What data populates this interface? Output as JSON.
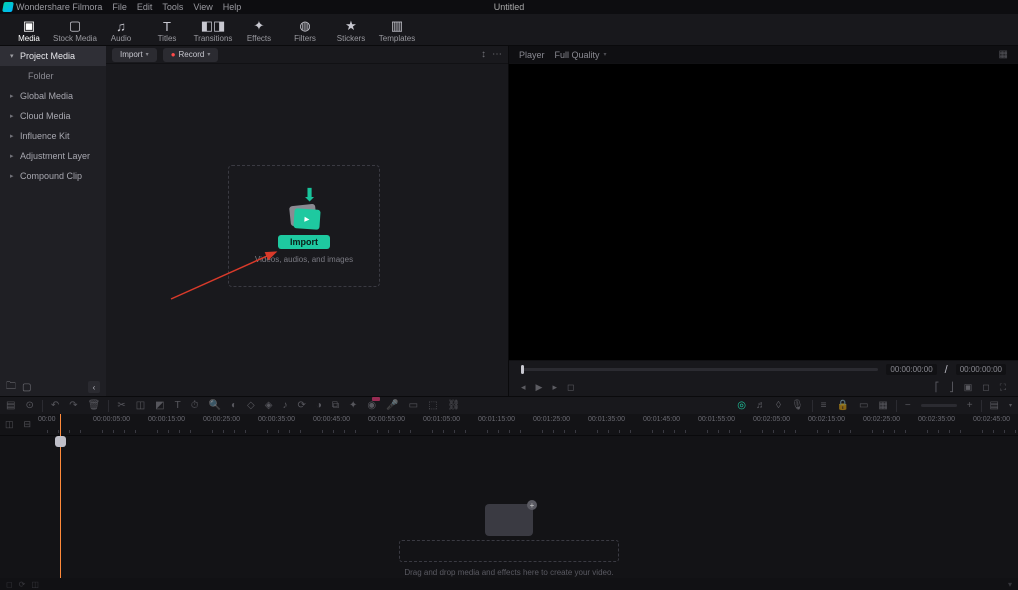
{
  "app_name": "Wondershare Filmora",
  "document_title": "Untitled",
  "menus": [
    "File",
    "Edit",
    "Tools",
    "View",
    "Help"
  ],
  "modes": [
    {
      "label": "Media",
      "icon": "▣"
    },
    {
      "label": "Stock Media",
      "icon": "▢"
    },
    {
      "label": "Audio",
      "icon": "♫"
    },
    {
      "label": "Titles",
      "icon": "T"
    },
    {
      "label": "Transitions",
      "icon": "◧◨"
    },
    {
      "label": "Effects",
      "icon": "✦"
    },
    {
      "label": "Filters",
      "icon": "◍"
    },
    {
      "label": "Stickers",
      "icon": "★"
    },
    {
      "label": "Templates",
      "icon": "▥"
    }
  ],
  "sidebar": {
    "items": [
      {
        "label": "Project Media"
      },
      {
        "label": "Global Media"
      },
      {
        "label": "Cloud Media"
      },
      {
        "label": "Influence Kit"
      },
      {
        "label": "Adjustment Layer"
      },
      {
        "label": "Compound Clip"
      }
    ],
    "folder_label": "Folder"
  },
  "media_toolbar": {
    "import_label": "Import",
    "record_label": "Record"
  },
  "drop_zone": {
    "button_label": "Import",
    "hint_text": "Videos, audios, and images"
  },
  "preview": {
    "player_label": "Player",
    "quality_label": "Full Quality",
    "time_current": "00:00:00:00",
    "time_total": "00:00:00:00",
    "slash": "/"
  },
  "timeline": {
    "ticks": [
      "00:00",
      "00:00:05:00",
      "00:00:15:00",
      "00:00:25:00",
      "00:00:35:00",
      "00:00:45:00",
      "00:00:55:00",
      "00:01:05:00",
      "00:01:15:00",
      "00:01:25:00",
      "00:01:35:00",
      "00:01:45:00",
      "00:01:55:00",
      "00:02:05:00",
      "00:02:15:00",
      "00:02:25:00",
      "00:02:35:00",
      "00:02:45:00"
    ],
    "placeholder_text": "Drag and drop media and effects here to create your video."
  }
}
